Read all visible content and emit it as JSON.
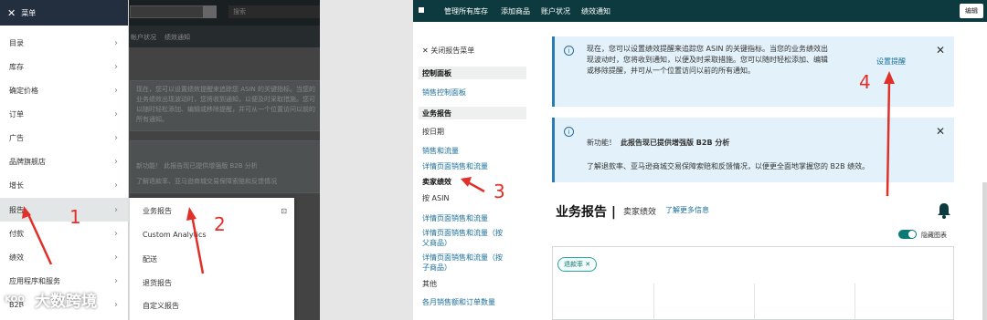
{
  "left": {
    "menu": {
      "close_icon": "✕",
      "title": "菜单",
      "items": [
        {
          "label": "目录"
        },
        {
          "label": "库存"
        },
        {
          "label": "确定价格"
        },
        {
          "label": "订单"
        },
        {
          "label": "广告"
        },
        {
          "label": "品牌旗舰店"
        },
        {
          "label": "增长"
        },
        {
          "label": "报告"
        },
        {
          "label": "付款"
        },
        {
          "label": "绩效"
        },
        {
          "label": "应用程序和服务"
        },
        {
          "label": "B2B"
        }
      ],
      "active_index": 7
    },
    "submenu": {
      "items": [
        {
          "label": "业务报告"
        },
        {
          "label": "Custom Analytics"
        },
        {
          "label": "配送"
        },
        {
          "label": "退货报告"
        },
        {
          "label": "自定义报告"
        }
      ]
    },
    "background": {
      "search_placeholder": "搜索",
      "nav": [
        "帐户状况",
        "绩效通知"
      ],
      "card1": "现在，您可以设置绩效提醒来追踪您 ASIN 的关键指标。当您的业务绩效出现波动时，您将收到通知，以便及时采取措施。您可以随时轻松添加、编辑或移除提醒，并可从一个位置访问以前的所有通知。",
      "card2": "新功能！ 此报告现已提供增强版 B2B 分析",
      "card2b": "了解退款率、亚马逊商城交易保障索赔和反馈情况"
    },
    "annotations": {
      "n1": "1",
      "n2": "2"
    },
    "watermark": {
      "logo": "KOO",
      "text": "大数跨境"
    }
  },
  "right": {
    "topbar": {
      "nav": [
        "管理所有库存",
        "添加商品",
        "账户状况",
        "绩效通知"
      ],
      "edit": "编辑"
    },
    "sidebar": {
      "close": "✕ 关闭报告菜单",
      "dashboard_header": "控制面板",
      "dashboard_link": "销售控制面板",
      "reports_header": "业务报告",
      "by_date": "按日期",
      "sales_traffic": "销售和流量",
      "detail_sales_traffic": "详情页面销售和流量",
      "seller_performance": "卖家绩效",
      "by_asin": "按 ASIN",
      "asin_detail": "详情页面销售和流量",
      "asin_parent_1": "详情页面销售和流量（按",
      "asin_parent_2": "父商品）",
      "asin_child_1": "详情页面销售和流量（按",
      "asin_child_2": "子商品）",
      "other": "其他",
      "monthly": "各月销售额和订单数量"
    },
    "banner1": {
      "line1": "现在，您可以设置绩效提醒来追踪您 ASIN 的关键指标。当您的业务绩效出",
      "line2": "现波动时，您将收到通知，以便及时采取措施。您可以随时轻松添加、编辑",
      "line3": "或移除提醒，并可从一个位置访问以前的所有通知。",
      "link": "设置提醒"
    },
    "banner2": {
      "line1_prefix": "新功能！",
      "line1_bold": "此报告现已提供增强版 B2B 分析",
      "line2": "了解退款率、亚马逊商城交易保障索赔和反馈情况，以便更全面地掌握您的 B2B 绩效。"
    },
    "page_title": "业务报告 |",
    "page_subtitle": "卖家绩效",
    "learn_more": "了解更多信息",
    "toggle_label": "隐藏图表",
    "chip": "退款率 ✕",
    "annotations": {
      "n3": "3",
      "n4": "4"
    },
    "colors": {
      "topbar": "#0c3a3e",
      "banner": "#e3f2fa",
      "link": "#1a6f9a",
      "annotation": "#e0302a"
    }
  }
}
